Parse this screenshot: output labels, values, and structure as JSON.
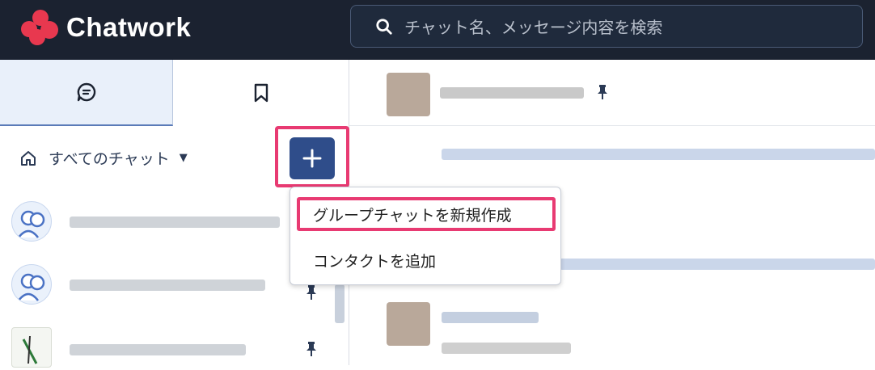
{
  "app": {
    "brand": "Chatwork",
    "brand_color": "#e8384f",
    "topbar_color": "#1b2230"
  },
  "search": {
    "placeholder": "チャット名、メッセージ内容を検索",
    "icon": "search-icon"
  },
  "tabs": [
    {
      "name": "chat-tab",
      "icon": "chat-bubble-icon",
      "active": true
    },
    {
      "name": "bookmark-tab",
      "icon": "bookmark-icon",
      "active": false
    }
  ],
  "filter": {
    "icon": "home-icon",
    "label": "すべてのチャット",
    "caret": "▼"
  },
  "add_button": {
    "symbol": "+",
    "color": "#2f4d8a"
  },
  "dropdown_menu": {
    "items": [
      {
        "label": "グループチャットを新規作成",
        "highlighted": true
      },
      {
        "label": "コンタクトを追加",
        "highlighted": false
      }
    ],
    "highlight_color": "#e83a72"
  }
}
